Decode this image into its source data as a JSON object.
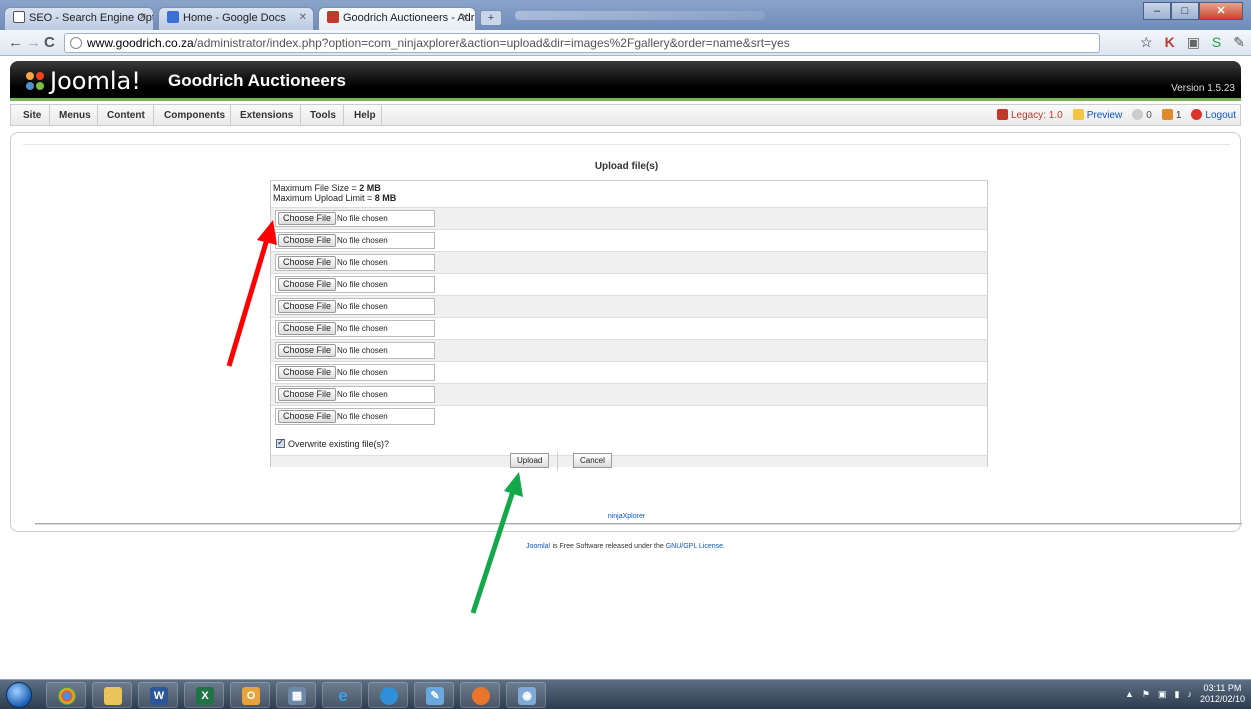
{
  "browser": {
    "tabs": [
      {
        "label": "SEO - Search Engine Optimi",
        "active": false
      },
      {
        "label": "Home - Google Docs",
        "active": false
      },
      {
        "label": "Goodrich Auctioneers - Adr",
        "active": true
      }
    ],
    "new_tab_label": "+",
    "url_host": "www.goodrich.co.za",
    "url_path": "/administrator/index.php?option=com_ninjaxplorer&action=upload&dir=images%2Fgallery&order=name&srt=yes"
  },
  "joomla": {
    "logo_text": "Joomla!",
    "site_name": "Goodrich Auctioneers",
    "version": "Version 1.5.23",
    "menu": [
      "Site",
      "Menus",
      "Content",
      "Components",
      "Extensions",
      "Tools",
      "Help"
    ],
    "status": {
      "legacy": "Legacy: 1.0",
      "preview": "Preview",
      "messages": "0",
      "users": "1",
      "logout": "Logout"
    }
  },
  "upload": {
    "title": "Upload file(s)",
    "max_file_size_label": "Maximum File Size = ",
    "max_file_size": "2 MB",
    "max_upload_label": "Maximum Upload Limit = ",
    "max_upload": "8 MB",
    "choose_file_label": "Choose File",
    "no_file_label": "No file chosen",
    "file_rows": 10,
    "overwrite_label": "Overwrite existing file(s)?",
    "overwrite_checked": true,
    "upload_button": "Upload",
    "cancel_button": "Cancel"
  },
  "ninja_link": "ninjaXplorer",
  "footer": {
    "joomla_link": "Joomla!",
    "text": " is Free Software released under the ",
    "license_link": "GNU/GPL License",
    "end": "."
  },
  "taskbar": {
    "time": "03:11 PM",
    "date": "2012/02/10"
  },
  "colors": {
    "joomla_green": "#7ab55c",
    "link_blue": "#0b55c4",
    "red_arrow": "#ff0000",
    "green_arrow": "#13a84a"
  }
}
